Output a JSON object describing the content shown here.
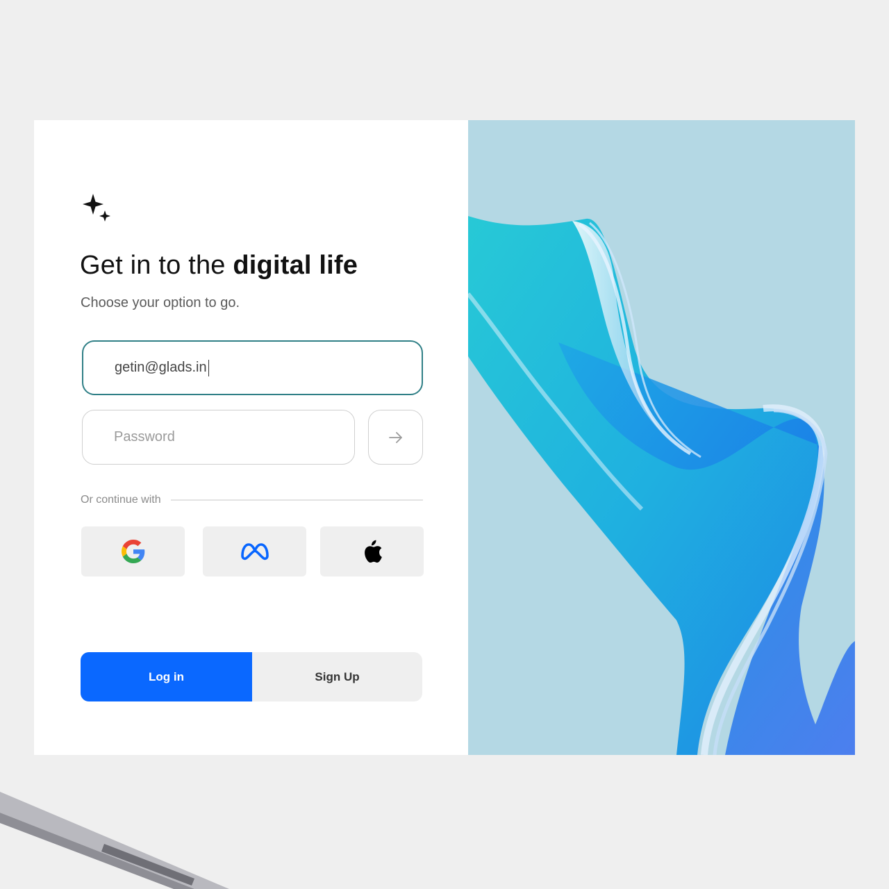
{
  "brand": {
    "icon": "sparkle-icon"
  },
  "headline": {
    "normal": "Get in to the ",
    "bold": "digital life"
  },
  "subtitle": "Choose your option to go.",
  "email": {
    "value": "getin@glads.in"
  },
  "password": {
    "placeholder": "Password"
  },
  "submit": {
    "icon": "arrow-right-icon"
  },
  "divider": {
    "label": "Or continue with"
  },
  "social": [
    {
      "provider": "Google",
      "icon": "google-icon"
    },
    {
      "provider": "Meta",
      "icon": "meta-icon"
    },
    {
      "provider": "Apple",
      "icon": "apple-icon"
    }
  ],
  "tabs": {
    "login": "Log in",
    "signup": "Sign Up",
    "active": "login"
  },
  "colors": {
    "accent": "#0a68ff",
    "focus_border": "#2f7f86",
    "hero_bg": "#b4d8e4",
    "page_bg": "#efefef"
  }
}
